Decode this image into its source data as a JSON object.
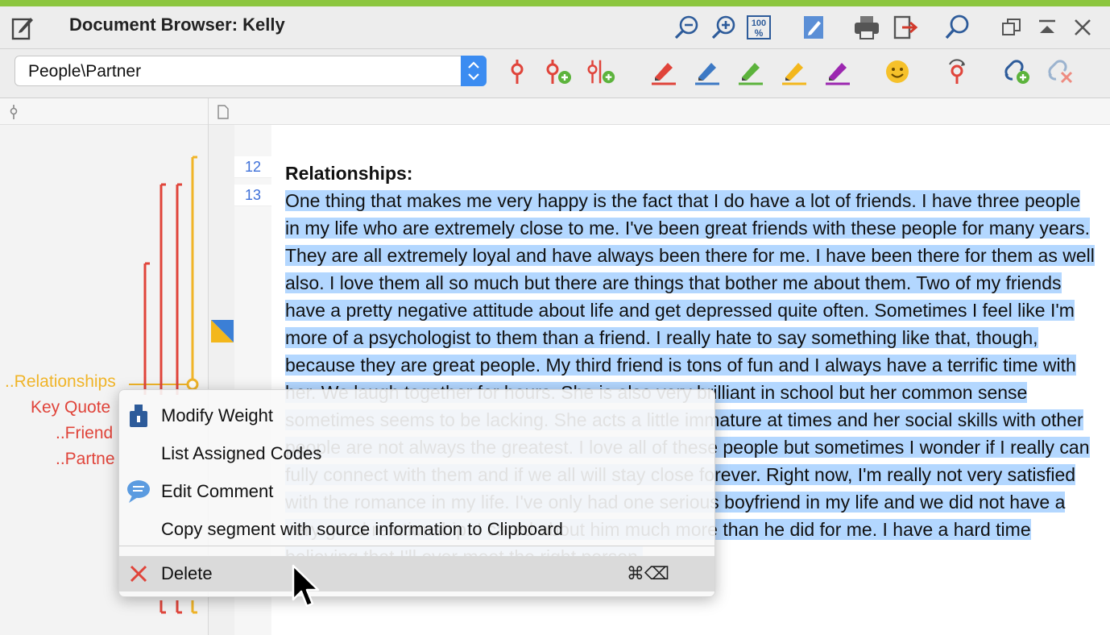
{
  "window": {
    "title": "Document Browser: Kelly",
    "accent_color": "#8cc63f"
  },
  "titlebar_icons": [
    "zoom-out-icon",
    "zoom-in-icon",
    "zoom-100-icon",
    "edit-mode-icon",
    "print-icon",
    "export-icon",
    "search-icon",
    "restore-window-icon",
    "collapse-icon",
    "close-icon"
  ],
  "zoom_100_label": "100",
  "toolbar": {
    "document_selector": {
      "value": "People\\Partner"
    },
    "code_icons": [
      "code-icon",
      "code-add-icon",
      "code-multiple-add-icon",
      "highlighter-red-icon",
      "highlighter-blue-icon",
      "highlighter-green-icon",
      "highlighter-yellow-icon",
      "highlighter-purple-icon",
      "emoticon-icon",
      "code-recent-icon",
      "link-add-icon",
      "link-remove-icon"
    ],
    "highlight_colors": {
      "red": "#e0443a",
      "blue": "#3d79c4",
      "green": "#5cb33c",
      "yellow": "#f3b71c",
      "purple": "#9c27b0"
    }
  },
  "code_labels": [
    {
      "text": "..Relationships",
      "color": "#f0b428"
    },
    {
      "text": "Key Quote",
      "color": "#e0443a"
    },
    {
      "text": "..Friend",
      "color": "#e0443a"
    },
    {
      "text": "..Partne",
      "color": "#e0443a"
    }
  ],
  "line_numbers": [
    "12",
    "13"
  ],
  "document": {
    "heading": "Relationships:",
    "paragraph": "One thing that makes me very happy is the fact that I do have a lot of friends.  I have three people in my life who are extremely close to me.  I've been great friends with these people for many years.  They are all extremely loyal and have always been there for me.  I have been there for them as well also.  I love them all so much but there are things that bother me about them.  Two of my friends have a pretty negative attitude about life and get depressed quite often.  Sometimes I feel like I'm more of a psychologist to them than a friend.  I really hate to say something like that, though, because they are great people.  My third friend is tons of fun and I always have a terrific time with her.  We laugh together for hours.  She is also very brilliant in school but her common sense sometimes seems to be lacking.  She acts a little immature at times and her social skills with other people are not always the greatest.  I love all of these people but sometimes I wonder if I really can fully connect with them and if we all will stay close forever.  Right now, I'm really not very satisfied with the romance in my life.  I've only had one serious boyfriend in my life and we did not have a very good relationship.  I cared about him much more than he did for me.  I have a hard time believing that I'll ever meet the right person."
  },
  "context_menu": {
    "items": [
      {
        "label": "Modify Weight",
        "icon": "weight-icon"
      },
      {
        "label": "List Assigned Codes",
        "icon": ""
      },
      {
        "label": "Edit Comment",
        "icon": "comment-icon"
      },
      {
        "label": "Copy segment with source information to Clipboard",
        "icon": ""
      },
      {
        "label": "Delete",
        "icon": "delete-x-icon",
        "shortcut": "⌘⌫",
        "highlighted": true
      }
    ]
  }
}
